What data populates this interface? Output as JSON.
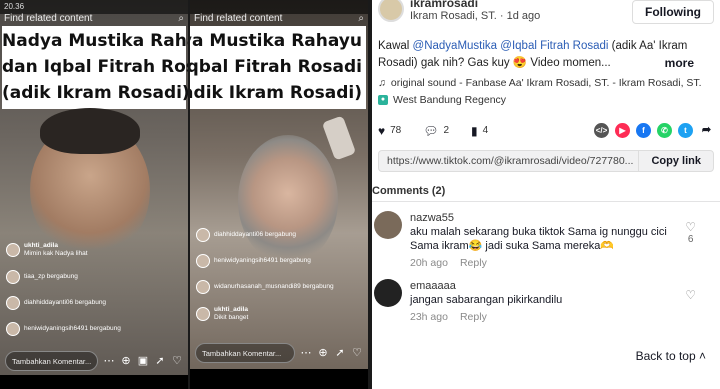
{
  "phone1": {
    "status_time": "20.36",
    "find_text": "Find related content",
    "title_lines": [
      "Nadya Mustika Rahayu",
      "dan Iqbal Fitrah Rosadi",
      "(adik Ikram Rosadi)"
    ],
    "feed": [
      {
        "name": "ukhti_adila",
        "text": "Mimin kak Nadya lihat"
      },
      {
        "name": "",
        "text": "tiaa_zp bergabung"
      },
      {
        "name": "",
        "text": "diahhiddayanti06 bergabung"
      },
      {
        "name": "",
        "text": "heniwidyaningsih6491 bergabung"
      }
    ],
    "comment_placeholder": "Tambahkan Komentar..."
  },
  "phone2": {
    "find_text": "Find related content",
    "feed": [
      {
        "name": "",
        "text": "diahhiddayanti06 bergabung"
      },
      {
        "name": "",
        "text": "heniwidyaningsih6491 bergabung"
      },
      {
        "name": "",
        "text": "widanurhasanah_musnandi89 bergabung"
      },
      {
        "name": "ukhti_adila",
        "text": "Dikit banget"
      }
    ],
    "comment_placeholder": "Tambahkan Komentar..."
  },
  "post": {
    "handle": "ikramrosadi",
    "sub": "Ikram Rosadi, ST. · 1d ago",
    "follow_label": "Following",
    "desc_prefix": "Kawal ",
    "mention1": "@NadyaMustika",
    "mention2": "@Iqbal Fitrah Rosadi",
    "desc_suffix": " (adik Aa' Ikram Rosadi) gak nih? Gas kuy 😍 Video momen...",
    "more_label": "more",
    "sound": "original sound - Fanbase Aa' Ikram Rosadi, ST. - Ikram Rosadi, ST.",
    "location": "West Bandung Regency",
    "likes": "78",
    "comments": "2",
    "saves": "4",
    "url": "https://www.tiktok.com/@ikramrosadi/video/727780...",
    "copy_label": "Copy link",
    "comments_heading": "Comments (2)",
    "back_to_top": "Back to top"
  },
  "comments": [
    {
      "user": "nazwa55",
      "text": "aku malah sekarang buka tiktok Sama ig nunggu cici Sama ikram😂 jadi suka Sama mereka🫶",
      "time": "20h ago",
      "reply": "Reply",
      "likes": "6",
      "avatar_color": "#7a6a5a"
    },
    {
      "user": "emaaaaa",
      "text": "jangan sabarangan pikirkandilu",
      "time": "23h ago",
      "reply": "Reply",
      "likes": "",
      "avatar_color": "#222222"
    }
  ],
  "share_icons": [
    {
      "name": "embed-icon",
      "color": "#555555",
      "glyph": "</>"
    },
    {
      "name": "send-icon",
      "color": "#fe2c55",
      "glyph": "▶"
    },
    {
      "name": "facebook-icon",
      "color": "#1877f2",
      "glyph": "f"
    },
    {
      "name": "whatsapp-icon",
      "color": "#25d366",
      "glyph": "✆"
    },
    {
      "name": "twitter-icon",
      "color": "#1da1f2",
      "glyph": "t"
    },
    {
      "name": "share-arrow-icon",
      "color": "#ffffff",
      "glyph": "➦"
    }
  ]
}
